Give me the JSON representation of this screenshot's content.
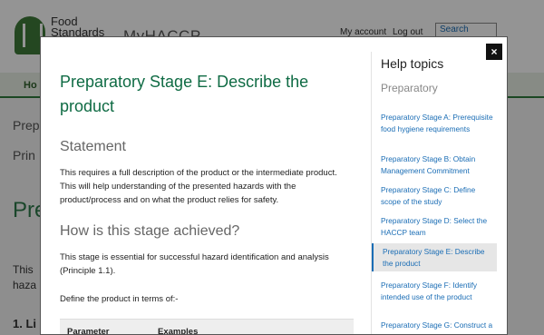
{
  "background": {
    "logo_line1": "Food",
    "logo_line2": "Standards",
    "app_name": "MyHACCP",
    "my_account": "My account",
    "log_out": "Log out",
    "search_placeholder": "Search",
    "nav_home": "Ho",
    "side_1": "Prep",
    "side_2": "Prin",
    "big_heading": "Pre",
    "text_1": "This",
    "text_2": "haza",
    "list_1": "1. Li"
  },
  "modal": {
    "close_label": "×",
    "title": "Preparatory Stage E: Describe the product",
    "statement_heading": "Statement",
    "statement_text": "This requires a full description of the product or the intermediate product. This will help understanding of the presented hazards with the product/process and on what the product relies for safety.",
    "how_heading": "How is this stage achieved?",
    "how_text": "This stage is essential for successful hazard identification and analysis (Principle 1.1).",
    "define_text": "Define the product in terms of:-",
    "table_headers": [
      "Parameter",
      "Examples"
    ]
  },
  "help": {
    "title": "Help topics",
    "subtitle": "Preparatory",
    "items": [
      "Preparatory Stage A: Prerequisite food hygiene requirements",
      "Preparatory Stage B: Obtain Management Commitment",
      "Preparatory Stage C: Define scope of the study",
      "Preparatory Stage D: Select the HACCP team",
      "Preparatory Stage E: Describe the product",
      "Preparatory Stage F: Identify intended use of the product",
      "Preparatory Stage G: Construct a flow diagram"
    ],
    "active_index": 4
  },
  "colors": {
    "title_green": "#0f6b44",
    "link_blue": "#1a6db5",
    "brand_green": "#2d7a3c"
  }
}
